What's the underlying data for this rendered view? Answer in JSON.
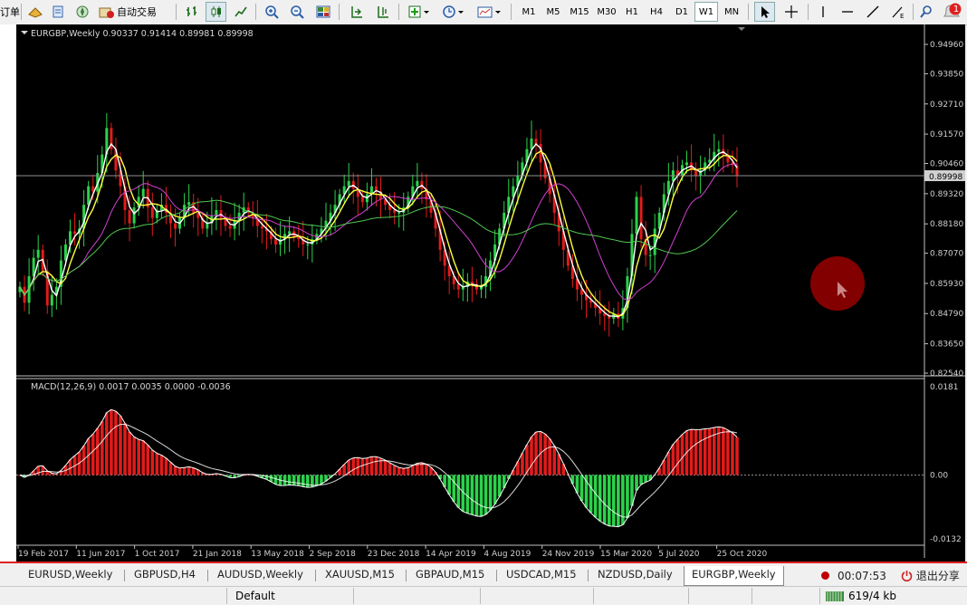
{
  "toolbar": {
    "order_label": "订单",
    "autotrade_label": "自动交易",
    "timeframes": [
      "M1",
      "M5",
      "M15",
      "M30",
      "H1",
      "H4",
      "D1",
      "W1",
      "MN"
    ],
    "active_timeframe": "W1",
    "notification_count": "1"
  },
  "chart": {
    "header": "EURGBP,Weekly  0.90337 0.91414 0.89981 0.89998",
    "current_price": "0.89998",
    "price_ticks": [
      "0.94960",
      "0.93850",
      "0.92710",
      "0.91570",
      "0.90460",
      "0.89320",
      "0.88180",
      "0.87070",
      "0.85930",
      "0.84790",
      "0.83650",
      "0.82540"
    ],
    "date_ticks": [
      "19 Feb 2017",
      "11 Jun 2017",
      "1 Oct 2017",
      "21 Jan 2018",
      "13 May 2018",
      "2 Sep 2018",
      "23 Dec 2018",
      "14 Apr 2019",
      "4 Aug 2019",
      "24 Nov 2019",
      "15 Mar 2020",
      "5 Jul 2020",
      "25 Oct 2020"
    ]
  },
  "macd": {
    "header": "MACD(12,26,9) 0.0017 0.0035 0.0000 -0.0036",
    "ticks": [
      "0.0181",
      "0.00",
      "-0.0132"
    ]
  },
  "tabs": {
    "items": [
      "EURUSD,Weekly",
      "GBPUSD,H4",
      "AUDUSD,Weekly",
      "XAUUSD,M15",
      "GBPAUD,M15",
      "USDCAD,M15",
      "NZDUSD,Daily",
      "EURGBP,Weekly"
    ],
    "active": "EURGBP,Weekly",
    "record_time": "00:07:53",
    "exit_share": "退出分享"
  },
  "status": {
    "profile": "Default",
    "traffic": "619/4 kb"
  },
  "chart_data": {
    "type": "candlestick",
    "symbol": "EURGBP",
    "timeframe": "Weekly",
    "ohlc_last": {
      "open": 0.90337,
      "high": 0.91414,
      "low": 0.89981,
      "close": 0.89998
    },
    "ylim": [
      0.8254,
      0.9496
    ],
    "x_labels": [
      "19 Feb 2017",
      "11 Jun 2017",
      "1 Oct 2017",
      "21 Jan 2018",
      "13 May 2018",
      "2 Sep 2018",
      "23 Dec 2018",
      "14 Apr 2019",
      "4 Aug 2019",
      "24 Nov 2019",
      "15 Mar 2020",
      "5 Jul 2020",
      "25 Oct 2020"
    ],
    "closes": [
      0.858,
      0.852,
      0.862,
      0.869,
      0.872,
      0.864,
      0.851,
      0.855,
      0.858,
      0.868,
      0.874,
      0.879,
      0.878,
      0.88,
      0.889,
      0.896,
      0.894,
      0.901,
      0.908,
      0.918,
      0.91,
      0.902,
      0.896,
      0.887,
      0.882,
      0.888,
      0.892,
      0.895,
      0.888,
      0.884,
      0.887,
      0.889,
      0.886,
      0.882,
      0.88,
      0.884,
      0.889,
      0.89,
      0.886,
      0.884,
      0.88,
      0.882,
      0.885,
      0.887,
      0.884,
      0.881,
      0.88,
      0.883,
      0.886,
      0.888,
      0.886,
      0.884,
      0.881,
      0.88,
      0.879,
      0.876,
      0.874,
      0.876,
      0.878,
      0.879,
      0.877,
      0.876,
      0.874,
      0.874,
      0.876,
      0.878,
      0.88,
      0.883,
      0.886,
      0.889,
      0.893,
      0.896,
      0.898,
      0.895,
      0.892,
      0.89,
      0.893,
      0.896,
      0.894,
      0.891,
      0.889,
      0.887,
      0.886,
      0.886,
      0.888,
      0.892,
      0.896,
      0.898,
      0.895,
      0.891,
      0.886,
      0.88,
      0.872,
      0.866,
      0.862,
      0.859,
      0.857,
      0.858,
      0.86,
      0.859,
      0.857,
      0.858,
      0.862,
      0.868,
      0.874,
      0.88,
      0.886,
      0.892,
      0.896,
      0.9,
      0.905,
      0.91,
      0.914,
      0.912,
      0.905,
      0.899,
      0.893,
      0.886,
      0.879,
      0.872,
      0.866,
      0.861,
      0.857,
      0.855,
      0.853,
      0.852,
      0.85,
      0.848,
      0.847,
      0.846,
      0.848,
      0.846,
      0.85,
      0.862,
      0.878,
      0.892,
      0.876,
      0.87,
      0.87,
      0.88,
      0.886,
      0.893,
      0.898,
      0.902,
      0.9,
      0.904,
      0.905,
      0.902,
      0.9,
      0.902,
      0.905,
      0.906,
      0.909,
      0.91,
      0.908,
      0.905,
      0.904,
      0.9
    ],
    "ma_series": [
      "white",
      "yellow",
      "magenta",
      "green"
    ],
    "macd": {
      "params": "12,26,9",
      "values": [
        0.0017,
        0.0035,
        0.0,
        -0.0036
      ],
      "ylim": [
        -0.0132,
        0.0181
      ]
    }
  },
  "colors": {
    "bull": "#2bd24b",
    "bear": "#e11b1b",
    "background": "#000000",
    "record_dot": "#c00000"
  }
}
